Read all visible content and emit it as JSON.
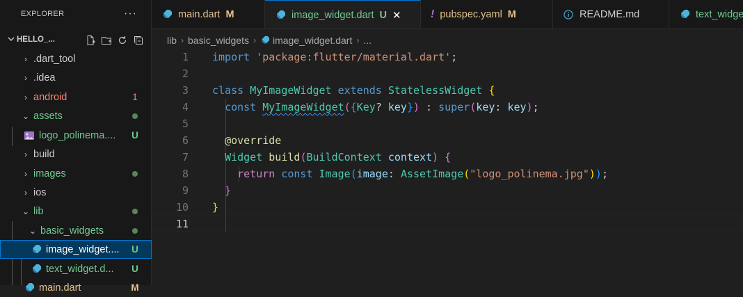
{
  "sidebar": {
    "title": "EXPLORER",
    "more": "···",
    "project": "HELLO_...",
    "items": [
      {
        "label": ".dart_tool",
        "color": "#cccccc",
        "badge": "",
        "dot": false
      },
      {
        "label": ".idea",
        "color": "#cccccc",
        "badge": "",
        "dot": false
      },
      {
        "label": "android",
        "color": "#f48771",
        "badge": "1",
        "badge_color": "#f48771",
        "dot": false
      },
      {
        "label": "assets",
        "color": "#73c991",
        "badge": "",
        "dot": true
      },
      {
        "label": "logo_polinema....",
        "color": "#73c991",
        "badge": "U",
        "badge_color": "#73c991",
        "dot": false
      },
      {
        "label": "build",
        "color": "#cccccc",
        "badge": "",
        "dot": false
      },
      {
        "label": "images",
        "color": "#73c991",
        "badge": "",
        "dot": true
      },
      {
        "label": "ios",
        "color": "#cccccc",
        "badge": "",
        "dot": false
      },
      {
        "label": "lib",
        "color": "#73c991",
        "badge": "",
        "dot": true
      },
      {
        "label": "basic_widgets",
        "color": "#73c991",
        "badge": "",
        "dot": true
      },
      {
        "label": "image_widget....",
        "color": "#ffffff",
        "badge": "U",
        "badge_color": "#73c991",
        "dot": false
      },
      {
        "label": "text_widget.d...",
        "color": "#73c991",
        "badge": "U",
        "badge_color": "#73c991",
        "dot": false
      },
      {
        "label": "main.dart",
        "color": "#e2c08d",
        "badge": "M",
        "badge_color": "#e2c08d",
        "dot": false
      }
    ]
  },
  "tabs": [
    {
      "label": "main.dart",
      "mark": "M",
      "color": "#e2c08d",
      "icon": "dart-icon"
    },
    {
      "label": "image_widget.dart",
      "mark": "U",
      "color": "#73c991",
      "icon": "dart-icon",
      "close": "✕"
    },
    {
      "label": "pubspec.yaml",
      "mark": "M",
      "color": "#e2c08d",
      "icon": "exclamation-icon"
    },
    {
      "label": "README.md",
      "mark": "",
      "color": "#cccccc",
      "icon": "info-icon"
    },
    {
      "label": "text_widget.dart",
      "mark": "",
      "color": "#73c991",
      "icon": "dart-icon"
    }
  ],
  "breadcrumb": {
    "parts": [
      "lib",
      "basic_widgets",
      "image_widget.dart",
      "..."
    ]
  },
  "editor": {
    "line_numbers": [
      "1",
      "2",
      "3",
      "4",
      "5",
      "6",
      "7",
      "8",
      "9",
      "10",
      "11"
    ],
    "current_line": "11",
    "code": {
      "l1": {
        "t1": "import",
        "t2": "'package:flutter/material.dart'",
        "t3": ";"
      },
      "l3": {
        "t1": "class",
        "t2": "MyImageWidget",
        "t3": "extends",
        "t4": "StatelessWidget",
        "t5": "{"
      },
      "l4": {
        "t1": "const",
        "t2": "MyImageWidget",
        "t3": "(",
        "t4": "{",
        "t5": "Key",
        "t6": "?",
        "t7": "key",
        "t8": "}",
        "t9": ")",
        "t10": " : ",
        "t11": "super",
        "t12": "(",
        "t13": "key",
        "t14": ": ",
        "t15": "key",
        "t16": ")",
        "t17": ";"
      },
      "l6": {
        "t1": "@override"
      },
      "l7": {
        "t1": "Widget",
        "t2": "build",
        "t3": "(",
        "t4": "BuildContext",
        "t5": "context",
        "t6": ")",
        "t7": "{"
      },
      "l8": {
        "t1": "return",
        "t2": "const",
        "t3": "Image",
        "t4": "(",
        "t5": "image",
        "t6": ": ",
        "t7": "AssetImage",
        "t8": "(",
        "t9": "\"logo_polinema.jpg\"",
        "t10": ")",
        "t11": ")",
        "t12": ";"
      },
      "l9": {
        "t1": "}"
      },
      "l10": {
        "t1": "}"
      }
    }
  }
}
